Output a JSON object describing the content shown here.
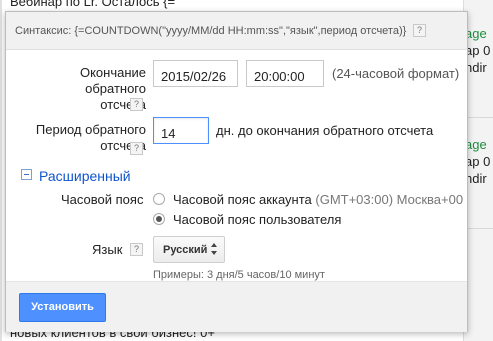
{
  "background": {
    "top_text": "Вебинар по Lr. Осталось {=",
    "bottom_text": "новых клиентов в свой бизнес! 0+",
    "right_fragments": [
      {
        "text": "age",
        "green": true
      },
      {
        "text": "ар 0",
        "green": false
      },
      {
        "text": "ndir",
        "green": false
      },
      {
        "text": "age",
        "green": true
      },
      {
        "text": "ар 0",
        "green": false
      },
      {
        "text": "ndir",
        "green": false
      }
    ]
  },
  "popup": {
    "syntax_text": "Синтаксис: {=COUNTDOWN(\"yyyy/MM/dd HH:mm:ss\",\"язык\",период отсчета)}",
    "help_glyph": "?",
    "end_label": "Окончание обратного отсчета",
    "end_date": "2015/02/26",
    "end_time": "20:00:00",
    "time_format_hint": "(24-часовой формат)",
    "period_label": "Период обратного отсчета",
    "period_value": "14",
    "period_suffix": "дн. до окончания обратного отсчета",
    "advanced_label": "Расширенный",
    "timezone_label": "Часовой пояс",
    "tz_account_label": "Часовой пояс аккаунта",
    "tz_account_detail": "(GMT+03:00) Москва+00",
    "tz_user_label": "Часовой пояс пользователя",
    "language_label": "Язык",
    "language_value": "Русский",
    "examples_text": "Примеры: 3 дня/5 часов/10 минут",
    "set_button": "Установить"
  },
  "colors": {
    "accent": "#4d90fe",
    "link": "#1155cc",
    "green": "#1e8e3e"
  }
}
